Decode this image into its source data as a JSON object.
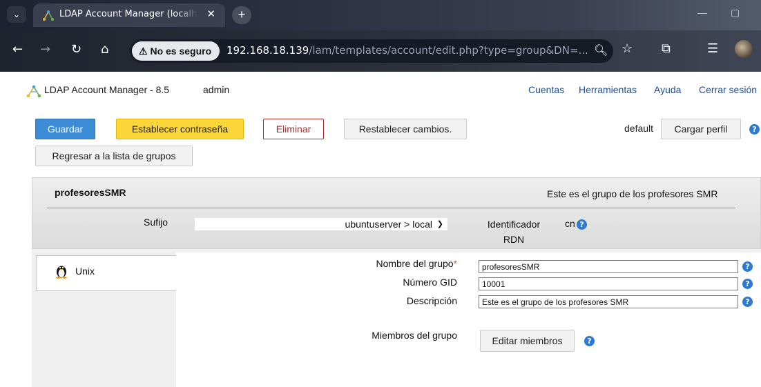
{
  "browser": {
    "tab_title": "LDAP Account Manager (localhost)",
    "security_label": "No es seguro",
    "url_host": "192.168.18.139",
    "url_path": "/lam/templates/account/edit.php?type=group&DN=..."
  },
  "app": {
    "title": "LDAP Account Manager - 8.5",
    "user": "admin",
    "nav": [
      "Cuentas",
      "Herramientas",
      "Ayuda",
      "Cerrar sesión"
    ]
  },
  "actions": {
    "save": "Guardar",
    "set_password": "Establecer contraseña",
    "delete": "Eliminar",
    "reset": "Restablecer cambios.",
    "back": "Regresar a la lista de grupos",
    "profile_name": "default",
    "load_profile": "Cargar perfil"
  },
  "account": {
    "name": "profesoresSMR",
    "description": "Este es el grupo de los profesores SMR",
    "suffix_label": "Sufijo",
    "suffix_value": "ubuntuserver > local",
    "rdn_label": "Identificador RDN",
    "rdn_value": "cn"
  },
  "module": {
    "label": "Unix"
  },
  "form": {
    "group_name_label": "Nombre del grupo",
    "required_mark": "*",
    "group_name_value": "profesoresSMR",
    "gid_label": "Número GID",
    "gid_value": "10001",
    "description_label": "Descripción",
    "description_value": "Este es el grupo de los profesores SMR",
    "members_label": "Miembros del grupo",
    "edit_members": "Editar miembros"
  },
  "help_glyph": "?"
}
